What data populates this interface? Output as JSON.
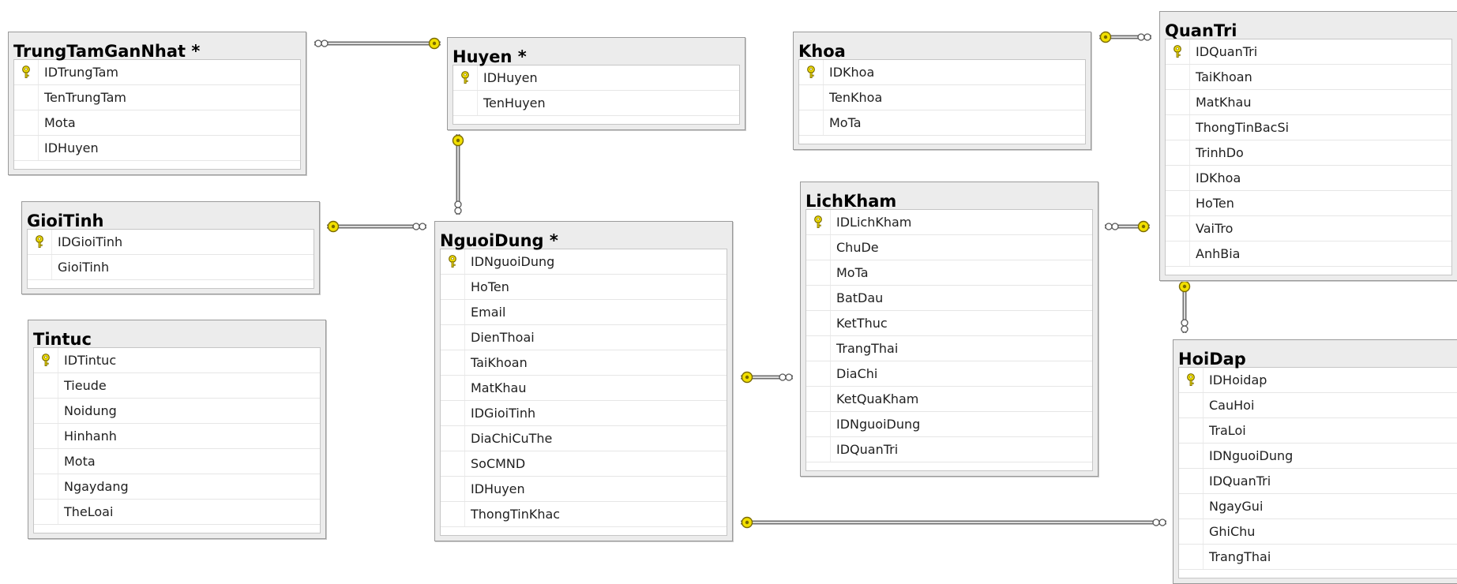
{
  "tables": {
    "trungtam": {
      "title": "TrungTamGanNhat *",
      "columns": [
        "IDTrungTam",
        "TenTrungTam",
        "Mota",
        "IDHuyen"
      ],
      "key_index": 0
    },
    "huyen": {
      "title": "Huyen *",
      "columns": [
        "IDHuyen",
        "TenHuyen"
      ],
      "key_index": 0
    },
    "gioitinh": {
      "title": "GioiTinh",
      "columns": [
        "IDGioiTinh",
        "GioiTinh"
      ],
      "key_index": 0
    },
    "tintuc": {
      "title": "Tintuc",
      "columns": [
        "IDTintuc",
        "Tieude",
        "Noidung",
        "Hinhanh",
        "Mota",
        "Ngaydang",
        "TheLoai"
      ],
      "key_index": 0
    },
    "nguoidung": {
      "title": "NguoiDung *",
      "columns": [
        "IDNguoiDung",
        "HoTen",
        "Email",
        "DienThoai",
        "TaiKhoan",
        "MatKhau",
        "IDGioiTinh",
        "DiaChiCuThe",
        "SoCMND",
        "IDHuyen",
        "ThongTinKhac"
      ],
      "key_index": 0
    },
    "khoa": {
      "title": "Khoa",
      "columns": [
        "IDKhoa",
        "TenKhoa",
        "MoTa"
      ],
      "key_index": 0
    },
    "lichkham": {
      "title": "LichKham",
      "columns": [
        "IDLichKham",
        "ChuDe",
        "MoTa",
        "BatDau",
        "KetThuc",
        "TrangThai",
        "DiaChi",
        "KetQuaKham",
        "IDNguoiDung",
        "IDQuanTri"
      ],
      "key_index": 0
    },
    "quantri": {
      "title": "QuanTri",
      "columns": [
        "IDQuanTri",
        "TaiKhoan",
        "MatKhau",
        "ThongTinBacSi",
        "TrinhDo",
        "IDKhoa",
        "HoTen",
        "VaiTro",
        "AnhBia"
      ],
      "key_index": 0
    },
    "hoidap": {
      "title": "HoiDap",
      "columns": [
        "IDHoidap",
        "CauHoi",
        "TraLoi",
        "IDNguoiDung",
        "IDQuanTri",
        "NgayGui",
        "GhiChu",
        "TrangThai"
      ],
      "key_index": 0
    }
  },
  "relationships": [
    {
      "name": "huyen-trungtam",
      "one": "huyen",
      "many": "trungtam"
    },
    {
      "name": "huyen-nguoidung",
      "one": "huyen",
      "many": "nguoidung"
    },
    {
      "name": "gioitinh-nguoidung",
      "one": "gioitinh",
      "many": "nguoidung"
    },
    {
      "name": "khoa-quantri",
      "one": "khoa",
      "many": "quantri"
    },
    {
      "name": "quantri-lichkham",
      "one": "quantri",
      "many": "lichkham"
    },
    {
      "name": "nguoidung-lichkham",
      "one": "nguoidung",
      "many": "lichkham"
    },
    {
      "name": "quantri-hoidap",
      "one": "quantri",
      "many": "hoidap"
    },
    {
      "name": "nguoidung-hoidap",
      "one": "nguoidung",
      "many": "hoidap"
    }
  ],
  "colors": {
    "key_yellow": "#f2e000",
    "key_outline": "#7a6a00",
    "line": "#6e6e6e",
    "header_bg": "#ececec"
  }
}
